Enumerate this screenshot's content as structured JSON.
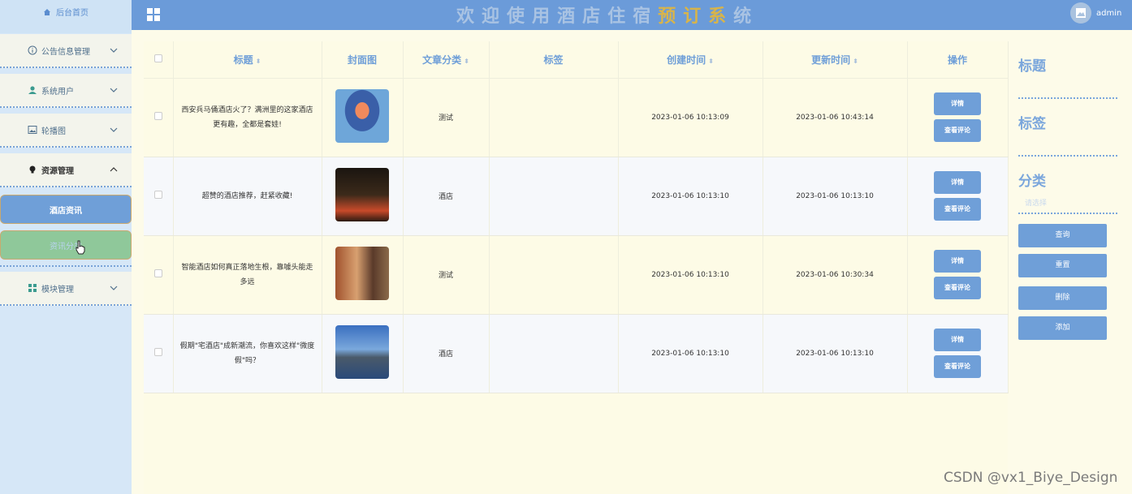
{
  "sidebar": {
    "home_label": "后台首页",
    "menus": [
      {
        "label": "公告信息管理",
        "icon": "info-circle-icon"
      },
      {
        "label": "系统用户",
        "icon": "user-icon"
      },
      {
        "label": "轮播图",
        "icon": "image-icon"
      },
      {
        "label": "资源管理",
        "icon": "bulb-icon"
      },
      {
        "label": "模块管理",
        "icon": "grid-icon"
      }
    ],
    "submenus": [
      {
        "label": "酒店资讯",
        "bg": "#6f9fd8"
      },
      {
        "label": "资讯分类",
        "bg": "#8fc89a"
      }
    ]
  },
  "header": {
    "title_chars": [
      "欢",
      "迎",
      "使",
      "用",
      "酒",
      "店",
      "住",
      "宿",
      "预",
      "订",
      "系",
      "统"
    ],
    "username": "admin"
  },
  "table": {
    "columns": [
      "标题",
      "封面图",
      "文章分类",
      "标签",
      "创建时间",
      "更新时间",
      "操作"
    ],
    "rows": [
      {
        "title": "西安兵马俑酒店火了？满洲里的这家酒店更有趣，全都是套娃!",
        "category": "测试",
        "tag": "",
        "created": "2023-01-06 10:13:09",
        "updated": "2023-01-06 10:43:14"
      },
      {
        "title": "超赞的酒店推荐，赶紧收藏!",
        "category": "酒店",
        "tag": "",
        "created": "2023-01-06 10:13:10",
        "updated": "2023-01-06 10:13:10"
      },
      {
        "title": "智能酒店如何真正落地生根，靠噱头能走多远",
        "category": "测试",
        "tag": "",
        "created": "2023-01-06 10:13:10",
        "updated": "2023-01-06 10:30:34"
      },
      {
        "title": "假期\"宅酒店\"成新潮流，你喜欢这样\"微度假\"吗？",
        "category": "酒店",
        "tag": "",
        "created": "2023-01-06 10:13:10",
        "updated": "2023-01-06 10:13:10"
      }
    ],
    "detail_label": "详情",
    "comment_label": "查看评论"
  },
  "filter": {
    "title_label": "标题",
    "tag_label": "标签",
    "category_label": "分类",
    "category_placeholder": "请选择",
    "buttons": [
      "查询",
      "重置",
      "删除",
      "添加"
    ]
  },
  "watermark": "CSDN @vx1_Biye_Design",
  "colors": {
    "primary": "#6f9fd8",
    "header": "#6b9bd9",
    "sidebar": "#d6e7f7",
    "gold": "#d8b44a",
    "active_green": "#8fc89a"
  }
}
